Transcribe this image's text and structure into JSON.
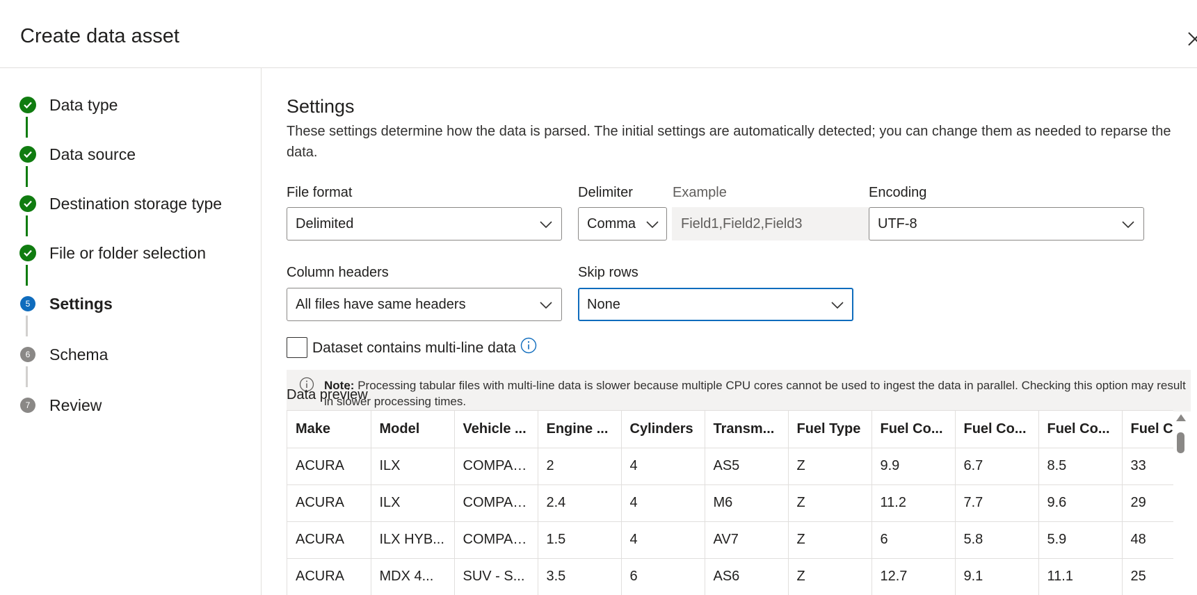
{
  "header": {
    "title": "Create data asset"
  },
  "steps": [
    {
      "label": "Data type",
      "state": "done",
      "icon": "checkmark-icon"
    },
    {
      "label": "Data source",
      "state": "done",
      "icon": "checkmark-icon"
    },
    {
      "label": "Destination storage type",
      "state": "done",
      "icon": "checkmark-icon"
    },
    {
      "label": "File or folder selection",
      "state": "done",
      "icon": "checkmark-icon"
    },
    {
      "label": "Settings",
      "state": "current",
      "number": "5"
    },
    {
      "label": "Schema",
      "state": "pending",
      "number": "6"
    },
    {
      "label": "Review",
      "state": "pending",
      "number": "7"
    }
  ],
  "settings": {
    "title": "Settings",
    "description": "These settings determine how the data is parsed. The initial settings are automatically detected; you can change them as needed to reparse the data.",
    "file_format": {
      "label": "File format",
      "value": "Delimited"
    },
    "delimiter": {
      "label": "Delimiter",
      "value": "Comma"
    },
    "example": {
      "label": "Example",
      "value": "Field1,Field2,Field3"
    },
    "encoding": {
      "label": "Encoding",
      "value": "UTF-8"
    },
    "column_headers": {
      "label": "Column headers",
      "value": "All files have same headers"
    },
    "skip_rows": {
      "label": "Skip rows",
      "value": "None"
    },
    "multiline": {
      "label": "Dataset contains multi-line data",
      "checked": false
    },
    "note": {
      "prefix": "Note:",
      "text": "Processing tabular files with multi-line data is slower because multiple CPU cores cannot be used to ingest the data in parallel. Checking this option may result in slower processing times."
    }
  },
  "preview": {
    "label": "Data preview",
    "columns": [
      "Make",
      "Model",
      "Vehicle ...",
      "Engine ...",
      "Cylinders",
      "Transm...",
      "Fuel Type",
      "Fuel Co...",
      "Fuel Co...",
      "Fuel Co...",
      "Fuel C"
    ],
    "rows": [
      [
        "ACURA",
        "ILX",
        "COMPACT",
        "2",
        "4",
        "AS5",
        "Z",
        "9.9",
        "6.7",
        "8.5",
        "33"
      ],
      [
        "ACURA",
        "ILX",
        "COMPACT",
        "2.4",
        "4",
        "M6",
        "Z",
        "11.2",
        "7.7",
        "9.6",
        "29"
      ],
      [
        "ACURA",
        "ILX HYB...",
        "COMPACT",
        "1.5",
        "4",
        "AV7",
        "Z",
        "6",
        "5.8",
        "5.9",
        "48"
      ],
      [
        "ACURA",
        "MDX 4...",
        "SUV - S...",
        "3.5",
        "6",
        "AS6",
        "Z",
        "12.7",
        "9.1",
        "11.1",
        "25"
      ]
    ]
  },
  "colors": {
    "done": "#107c10",
    "current": "#0f6cbd",
    "pending": "#8a8886",
    "focus": "#0f6cbd"
  }
}
